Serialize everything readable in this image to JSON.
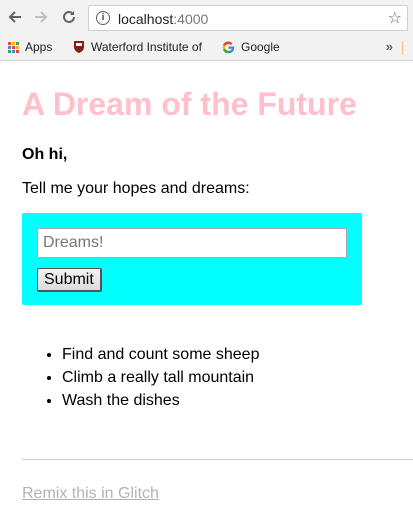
{
  "browser": {
    "url_host": "localhost",
    "url_port": ":4000",
    "icons": {
      "back": "back-arrow-icon",
      "forward": "forward-arrow-icon",
      "reload": "reload-icon",
      "info": "info-icon",
      "star": "bookmark-star-icon"
    },
    "bookmarks": [
      {
        "label": "Apps",
        "icon": "apps-grid-icon"
      },
      {
        "label": "Waterford Institute of",
        "icon": "crest-icon"
      },
      {
        "label": "Google",
        "icon": "google-g-icon"
      }
    ],
    "more_bookmarks": "»"
  },
  "page": {
    "title": "A Dream of the Future",
    "greeting": "Oh hi,",
    "prompt": "Tell me your hopes and dreams:",
    "form": {
      "placeholder": "Dreams!",
      "submit_label": "Submit"
    },
    "dreams": [
      "Find and count some sheep",
      "Climb a really tall mountain",
      "Wash the dishes"
    ],
    "remix_link": "Remix this in Glitch"
  },
  "colors": {
    "title": "#ffc0cb",
    "form_background": "#00ffff",
    "link": "#b3b3b3"
  }
}
